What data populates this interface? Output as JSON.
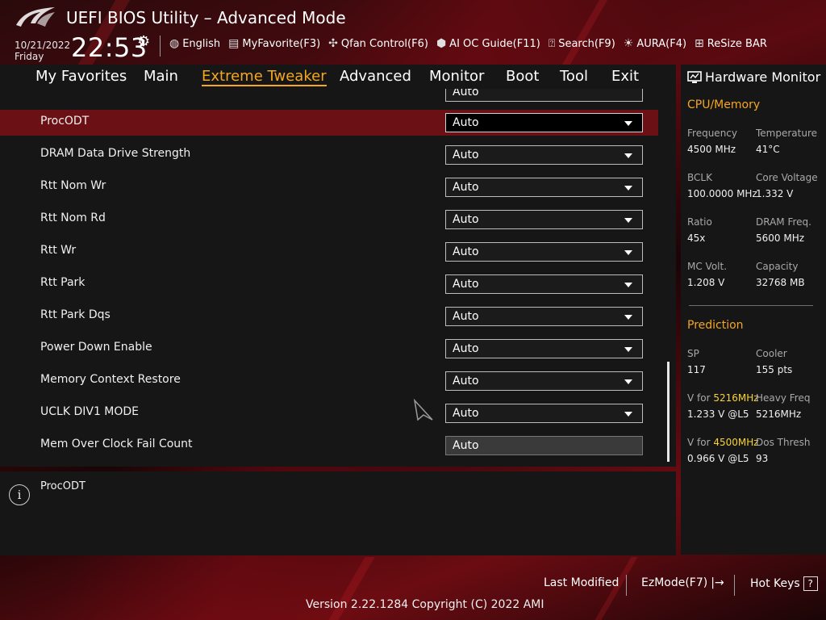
{
  "header": {
    "title": "UEFI BIOS Utility – Advanced Mode",
    "date": "10/21/2022",
    "day": "Friday",
    "time": "22:53"
  },
  "toolbar": [
    {
      "name": "language",
      "icon": "globe-icon",
      "label": "English"
    },
    {
      "name": "myfavorite",
      "icon": "favorite-list-icon",
      "label": "MyFavorite(F3)"
    },
    {
      "name": "qfan",
      "icon": "fan-icon",
      "label": "Qfan Control(F6)"
    },
    {
      "name": "ai-oc-guide",
      "icon": "chip-icon",
      "label": "AI OC Guide(F11)"
    },
    {
      "name": "search",
      "icon": "search-box-icon",
      "label": "Search(F9)"
    },
    {
      "name": "aura",
      "icon": "aura-light-icon",
      "label": "AURA(F4)"
    },
    {
      "name": "resize-bar",
      "icon": "resize-bar-icon",
      "label": "ReSize BAR"
    }
  ],
  "nav": [
    {
      "label": "My Favorites",
      "active": false
    },
    {
      "label": "Main",
      "active": false
    },
    {
      "label": "Extreme Tweaker",
      "active": true
    },
    {
      "label": "Advanced",
      "active": false
    },
    {
      "label": "Monitor",
      "active": false
    },
    {
      "label": "Boot",
      "active": false
    },
    {
      "label": "Tool",
      "active": false
    },
    {
      "label": "Exit",
      "active": false
    }
  ],
  "settings": [
    {
      "label": "ProcODT",
      "value": "Auto",
      "selected": true,
      "disabled": false
    },
    {
      "label": "DRAM Data Drive Strength",
      "value": "Auto",
      "selected": false,
      "disabled": false
    },
    {
      "label": "Rtt Nom Wr",
      "value": "Auto",
      "selected": false,
      "disabled": false
    },
    {
      "label": "Rtt Nom Rd",
      "value": "Auto",
      "selected": false,
      "disabled": false
    },
    {
      "label": "Rtt Wr",
      "value": "Auto",
      "selected": false,
      "disabled": false
    },
    {
      "label": "Rtt Park",
      "value": "Auto",
      "selected": false,
      "disabled": false
    },
    {
      "label": "Rtt Park Dqs",
      "value": "Auto",
      "selected": false,
      "disabled": false
    },
    {
      "label": "Power Down Enable",
      "value": "Auto",
      "selected": false,
      "disabled": false
    },
    {
      "label": "Memory Context Restore",
      "value": "Auto",
      "selected": false,
      "disabled": false
    },
    {
      "label": "UCLK DIV1 MODE",
      "value": "Auto",
      "selected": false,
      "disabled": false
    },
    {
      "label": "Mem Over Clock Fail Count",
      "value": "Auto",
      "selected": false,
      "disabled": true
    }
  ],
  "partial_top_value": "Auto",
  "help": {
    "text": "ProcODT"
  },
  "hardware_monitor": {
    "title": "Hardware Monitor",
    "cpu_memory_title": "CPU/Memory",
    "items": [
      {
        "label": "Frequency",
        "value": "4500 MHz"
      },
      {
        "label": "Temperature",
        "value": "41°C"
      },
      {
        "label": "BCLK",
        "value": "100.0000 MHz"
      },
      {
        "label": "Core Voltage",
        "value": "1.332 V"
      },
      {
        "label": "Ratio",
        "value": "45x"
      },
      {
        "label": "DRAM Freq.",
        "value": "5600 MHz"
      },
      {
        "label": "MC Volt.",
        "value": "1.208 V"
      },
      {
        "label": "Capacity",
        "value": "32768 MB"
      }
    ],
    "prediction_title": "Prediction",
    "prediction": {
      "sp_label": "SP",
      "sp_value": "117",
      "cooler_label": "Cooler",
      "cooler_value": "155 pts",
      "v1_prefix": "V for ",
      "v1_freq": "5216MHz",
      "v1_value": "1.233 V @L5",
      "heavy_label": "Heavy Freq",
      "heavy_value": "5216MHz",
      "v2_prefix": "V for ",
      "v2_freq": "4500MHz",
      "v2_value": "0.966 V @L5",
      "dos_label": "Dos Thresh",
      "dos_value": "93"
    }
  },
  "footer": {
    "last_modified": "Last Modified",
    "ezmode": "EzMode(F7)",
    "hotkeys": "Hot Keys",
    "hotkeys_key": "?",
    "version": "Version 2.22.1284 Copyright (C) 2022 AMI"
  },
  "colors": {
    "accent": "#f5a623",
    "selected_row": "#6b1014",
    "highlight": "#f5d23a"
  }
}
